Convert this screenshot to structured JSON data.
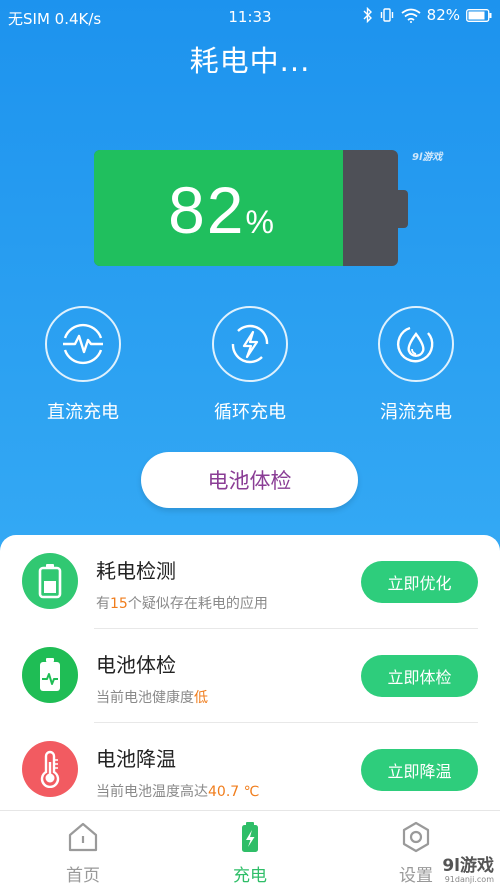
{
  "status_bar": {
    "carrier": "无SIM",
    "speed": "0.4K/s",
    "time": "11:33",
    "battery_pct": "82%"
  },
  "header": {
    "title": "耗电中..."
  },
  "watermark_top": "9l游戏",
  "battery": {
    "level": 0.82,
    "value": "82",
    "unit": "%",
    "fill_color": "#20bf5e",
    "empty_color": "#4e5057"
  },
  "modes": [
    {
      "label": "直流充电",
      "icon": "dc-charge-icon"
    },
    {
      "label": "循环充电",
      "icon": "cycle-charge-icon"
    },
    {
      "label": "涓流充电",
      "icon": "trickle-charge-icon"
    }
  ],
  "check_button": {
    "label": "电池体检"
  },
  "list": [
    {
      "title": "耗电检测",
      "sub_pre": "有",
      "sub_hl": "15",
      "sub_post": "个疑似存在耗电的应用",
      "button": "立即优化",
      "icon": "battery-drain-icon",
      "icon_color": "#31c872"
    },
    {
      "title": "电池体检",
      "sub_pre": "当前电池健康度",
      "sub_hl": "低",
      "sub_post": "",
      "button": "立即体检",
      "icon": "battery-health-icon",
      "icon_color": "#1fbd55"
    },
    {
      "title": "电池降温",
      "sub_pre": "当前电池温度高达",
      "sub_hl": "40.7 ℃",
      "sub_post": "",
      "button": "立即降温",
      "icon": "thermometer-icon",
      "icon_color": "#f25b61"
    }
  ],
  "tabs": [
    {
      "label": "首页",
      "icon": "home-icon",
      "active": false
    },
    {
      "label": "充电",
      "icon": "charge-icon",
      "active": true
    },
    {
      "label": "设置",
      "icon": "settings-icon",
      "active": false
    }
  ],
  "watermark_bottom": {
    "main": "9l游戏",
    "sub": "91danji.com"
  },
  "colors": {
    "accent_green": "#2ecd7c",
    "header_blue": "#1d93ee",
    "highlight_orange": "#f07d1c",
    "check_text": "#8a3d95"
  }
}
